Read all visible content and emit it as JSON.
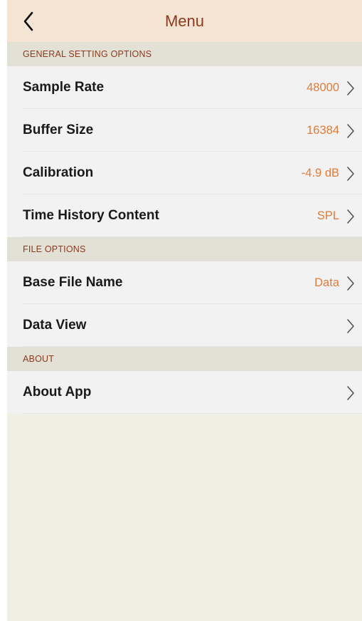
{
  "header": {
    "title": "Menu",
    "back_icon": "chevron-left-icon"
  },
  "sections": [
    {
      "title": "GENERAL SETTING OPTIONS",
      "rows": [
        {
          "label": "Sample Rate",
          "value": "48000"
        },
        {
          "label": "Buffer Size",
          "value": "16384"
        },
        {
          "label": "Calibration",
          "value": "-4.9 dB"
        },
        {
          "label": "Time History Content",
          "value": "SPL"
        }
      ]
    },
    {
      "title": "FILE OPTIONS",
      "rows": [
        {
          "label": "Base File Name",
          "value": "Data"
        },
        {
          "label": "Data View",
          "value": ""
        }
      ]
    },
    {
      "title": "ABOUT",
      "rows": [
        {
          "label": "About App",
          "value": ""
        }
      ]
    }
  ],
  "colors": {
    "accent_value": "#e07b39",
    "title_brown": "#8b3a1e",
    "nav_background": "#f4e4d4",
    "section_background": "#e3e1d5",
    "row_background": "#f2f2f2",
    "screen_background": "#efefe3"
  },
  "row_icon": "chevron-right-icon"
}
